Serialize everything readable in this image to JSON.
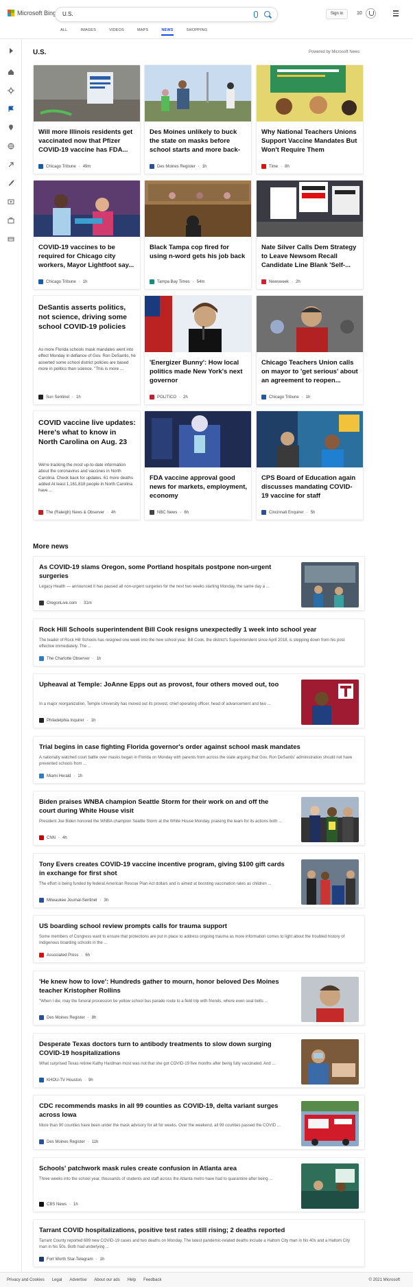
{
  "app": {
    "brand": "Microsoft Bing"
  },
  "search": {
    "query": "U.S."
  },
  "header": {
    "sign_in": "Sign in",
    "points": "10"
  },
  "tabs": [
    "ALL",
    "IMAGES",
    "VIDEOS",
    "MAPS",
    "NEWS",
    "SHOPPING"
  ],
  "active_tab": "NEWS",
  "section": {
    "title": "U.S.",
    "powered": "Powered by Microsoft News"
  },
  "cards": [
    {
      "title": "Will more Illinois residents get vaccinated now that Pfizer COVID-19 vaccine has FDA...",
      "source": "Chicago Tribune",
      "time": "49m",
      "fav": "#1a5aa8",
      "img": "img-vaccine-sign"
    },
    {
      "title": "Des Moines unlikely to buck the state on masks before school starts and more back-to-scho...",
      "source": "Des Moines Register",
      "time": "1h",
      "fav": "#2a4f9c",
      "img": "img-students-walk"
    },
    {
      "title": "Why National Teachers Unions Support Vaccine Mandates But Won't Require Them",
      "source": "Time",
      "time": "8h",
      "fav": "#d11",
      "img": "img-classroom"
    },
    {
      "title": "COVID-19 vaccines to be required for Chicago city workers, Mayor Lightfoot say...",
      "source": "Chicago Tribune",
      "time": "1h",
      "fav": "#1a5aa8",
      "img": "img-vaccination"
    },
    {
      "title": "Black Tampa cop fired for using n-word gets his job back",
      "source": "Tampa Bay Times",
      "time": "54m",
      "fav": "#1f8a7a",
      "img": "img-hearing"
    },
    {
      "title": "Nate Silver Calls Dem Strategy to Leave Newsom Recall Candidate Line Blank 'Self-...",
      "source": "Newsweek",
      "time": "2h",
      "fav": "#d3202e",
      "img": "img-protest"
    },
    {
      "title": "DeSantis asserts politics, not science, driving some school COVID-19 policies",
      "snippet": "As more Florida schools mask mandates went into effect Monday in defiance of Gov. Ron DeSantis, he asserted some school district policies are based more in politics than science. \"This is more ...",
      "source": "Sun Sentinel",
      "time": "1h",
      "fav": "#222",
      "img": ""
    },
    {
      "title": "'Energizer Bunny': How local politics made New York's next governor",
      "source": "POLITICO",
      "time": "2h",
      "fav": "#c0202a",
      "img": "img-governor"
    },
    {
      "title": "Chicago Teachers Union calls on mayor to 'get serious' about an agreement to reopen...",
      "source": "Chicago Tribune",
      "time": "1h",
      "fav": "#1a5aa8",
      "img": "img-union"
    },
    {
      "title": "COVID vaccine live updates: Here's what to know in North Carolina on Aug. 23",
      "snippet": "We're tracking the most up-to-date information about the coronavirus and vaccines in North Carolina. Check back for updates. 61 more deaths added At least 1,161,818 people in North Carolina have ...",
      "source": "The (Raleigh) News & Observer",
      "time": "4h",
      "fav": "#b22",
      "img": ""
    },
    {
      "title": "FDA vaccine approval good news for markets, employment, economy",
      "source": "NBC News",
      "time": "6h",
      "fav": "#444",
      "img": "img-lab"
    },
    {
      "title": "CPS Board of Education again discusses mandating COVID-19 vaccine for staff",
      "source": "Cincinnati Enquirer",
      "time": "5h",
      "fav": "#2a4f9c",
      "img": "img-school"
    }
  ],
  "more_news": {
    "title": "More news"
  },
  "rows": [
    {
      "title": "As COVID-19 slams Oregon, some Portland hospitals postpone non-urgent surgeries",
      "snippet": "Legacy Health — announced it has paused all non-urgent surgeries for the next two weeks starting Monday, the same day a ...",
      "source": "OregonLive.com",
      "time": "31m",
      "fav": "#333",
      "img": "img-hospital"
    },
    {
      "title": "Rock Hill Schools superintendent Bill Cook resigns unexpectedly 1 week into school year",
      "snippet": "The leader of Rock Hill Schools has resigned one week into the new school year. Bill Cook, the district's Superintendent since April 2018, is stepping down from his post effective immediately. The ...",
      "source": "The Charlotte Observer",
      "time": "1h",
      "fav": "#2e7cc4",
      "img": ""
    },
    {
      "title": "Upheaval at Temple: JoAnne Epps out as provost, four others moved out, too",
      "snippet": "In a major reorganization, Temple University has moved out its provost, chief operating officer, head of advancement and two ...",
      "source": "Philadelphia Inquirer",
      "time": "1h",
      "fav": "#222",
      "img": "img-temple"
    },
    {
      "title": "Trial begins in case fighting Florida governor's order against school mask mandates",
      "snippet": "A nationally watched court battle over masks began in Florida on Monday with parents from across the state arguing that Gov. Ron DeSantis' administration should not have prevented schools from ...",
      "source": "Miami Herald",
      "time": "1h",
      "fav": "#2e7cc4",
      "img": ""
    },
    {
      "title": "Biden praises WNBA champion Seattle Storm for their work on and off the court during White House visit",
      "snippet": "President Joe Biden honored the WNBA champion Seattle Storm at the White House Monday, praising the team for its actions both ...",
      "source": "CNN",
      "time": "4h",
      "fav": "#cc0000",
      "img": "img-biden"
    },
    {
      "title": "Tony Evers creates COVID-19 vaccine incentive program, giving $100 gift cards in exchange for first shot",
      "snippet": "The effort is being funded by federal American Rescue Plan Act dollars and is aimed at boosting vaccination rates as children ...",
      "source": "Milwaukee Journal-Sentinel",
      "time": "3h",
      "fav": "#2a4f9c",
      "img": "img-evers"
    },
    {
      "title": "US boarding school review prompts calls for trauma support",
      "snippet": "Some members of Congress want to ensure that protections are put in place to address ongoing trauma as more information comes to light about the troubled history of Indigenous boarding schools in the ...",
      "source": "Associated Press",
      "time": "6h",
      "fav": "#d11",
      "img": ""
    },
    {
      "title": "'He knew how to love': Hundreds gather to mourn, honor beloved Des Moines teacher Kristopher Rollins",
      "snippet": "\"When I die, may the funeral procession be yellow school bus parade route to a field trip with friends, where even seat belts ...",
      "source": "Des Moines Register",
      "time": "8h",
      "fav": "#2a4f9c",
      "img": "img-teacher"
    },
    {
      "title": "Desperate Texas doctors turn to antibody treatments to slow down surging COVID-19 hospitalizations",
      "snippet": "What surprised Texas retiree Kathy Hardman most was not that she got COVID-19 five months after being fully vaccinated. And ...",
      "source": "KHOU-TV Houston",
      "time": "9h",
      "fav": "#1a5aa8",
      "img": "img-doctor"
    },
    {
      "title": "CDC recommends masks in all 99 counties as COVID-19, delta variant surges across Iowa",
      "snippet": "More than 90 counties have been under the mask advisory for all for weeks. Over the weekend, all 99 counties passed the COVID ...",
      "source": "Des Moines Register",
      "time": "11h",
      "fav": "#2a4f9c",
      "img": "img-health-truck"
    },
    {
      "title": "Schools' patchwork mask rules create confusion in Atlanta area",
      "snippet": "Three weeks into the school year, thousands of students and staff across the Atlanta metro have had to quarantine after being ...",
      "source": "CBS News",
      "time": "1h",
      "fav": "#111",
      "img": "img-class-green"
    },
    {
      "title": "Tarrant COVID hospitalizations, positive test rates still rising; 2 deaths reported",
      "snippet": "Tarrant County reported 689 new COVID-19 cases and two deaths on Monday. The latest pandemic-related deaths include a Haltom City man in his 40s and a Haltom City man in his 50s. Both had underlying ...",
      "source": "Fort Worth Star-Telegram",
      "time": "1h",
      "fav": "#1a3a6e",
      "img": ""
    }
  ],
  "footer": {
    "links": [
      "Privacy and Cookies",
      "Legal",
      "Advertise",
      "About our ads",
      "Help",
      "Feedback"
    ],
    "copyright": "© 2021 Microsoft"
  }
}
